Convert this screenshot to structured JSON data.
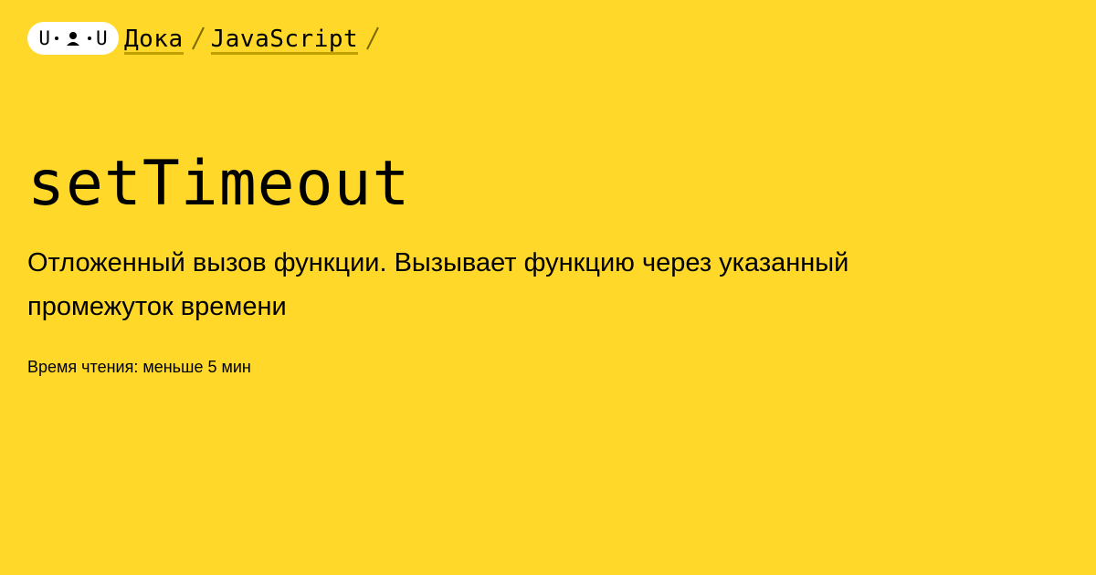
{
  "header": {
    "logo": {
      "left_letter": "U",
      "right_letter": "U",
      "icon": "face-icon"
    },
    "breadcrumbs": [
      {
        "label": "Дока"
      },
      {
        "label": "JavaScript"
      }
    ],
    "separator_icon": "slash-separator-icon"
  },
  "article": {
    "title": "setTimeout",
    "description": "Отложенный вызов функции. Вызывает функцию через указанный промежуток времени",
    "reading_time": "Время чтения: меньше 5 мин"
  },
  "colors": {
    "background": "#ffd829",
    "text": "#000000",
    "logo_background": "#ffffff",
    "link_underline": "#c0a000"
  }
}
